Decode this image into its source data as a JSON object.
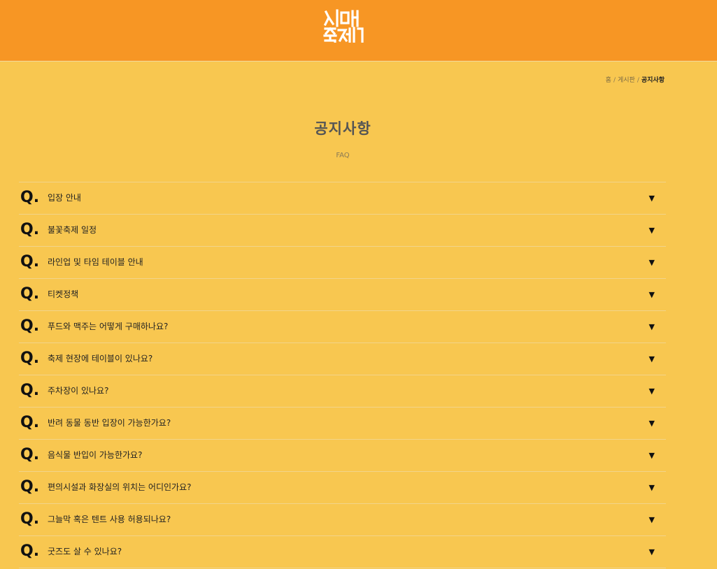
{
  "header": {
    "logo_text": "시맥 축제",
    "logo_icon": "sim-maek-logo"
  },
  "breadcrumb": {
    "home": "홈",
    "board": "게시판",
    "current": "공지사항",
    "separator": "/"
  },
  "page": {
    "title": "공지사항",
    "subtitle": "FAQ"
  },
  "faq": {
    "q_label": "Q.",
    "expand_icon": "triangle-down",
    "items": [
      {
        "question": "입장 안내"
      },
      {
        "question": "불꽃축제 일정"
      },
      {
        "question": "라인업 및 타임 테이블 안내"
      },
      {
        "question": "티켓정책"
      },
      {
        "question": "푸드와 맥주는 어떻게 구매하나요?"
      },
      {
        "question": "축제 현장에 테이블이 있나요?"
      },
      {
        "question": "주차장이 있나요?"
      },
      {
        "question": "반려 동물 동반 입장이 가능한가요?"
      },
      {
        "question": "음식물 반입이 가능한가요?"
      },
      {
        "question": "편의시설과 화장실의 위치는 어디인가요?"
      },
      {
        "question": "그늘막 혹은 텐트 사용 허용되나요?"
      },
      {
        "question": "굿즈도 살 수 있나요?"
      }
    ]
  },
  "colors": {
    "header_bg": "#F79624",
    "page_bg": "#F8C750",
    "logo": "#FFFFFF"
  }
}
